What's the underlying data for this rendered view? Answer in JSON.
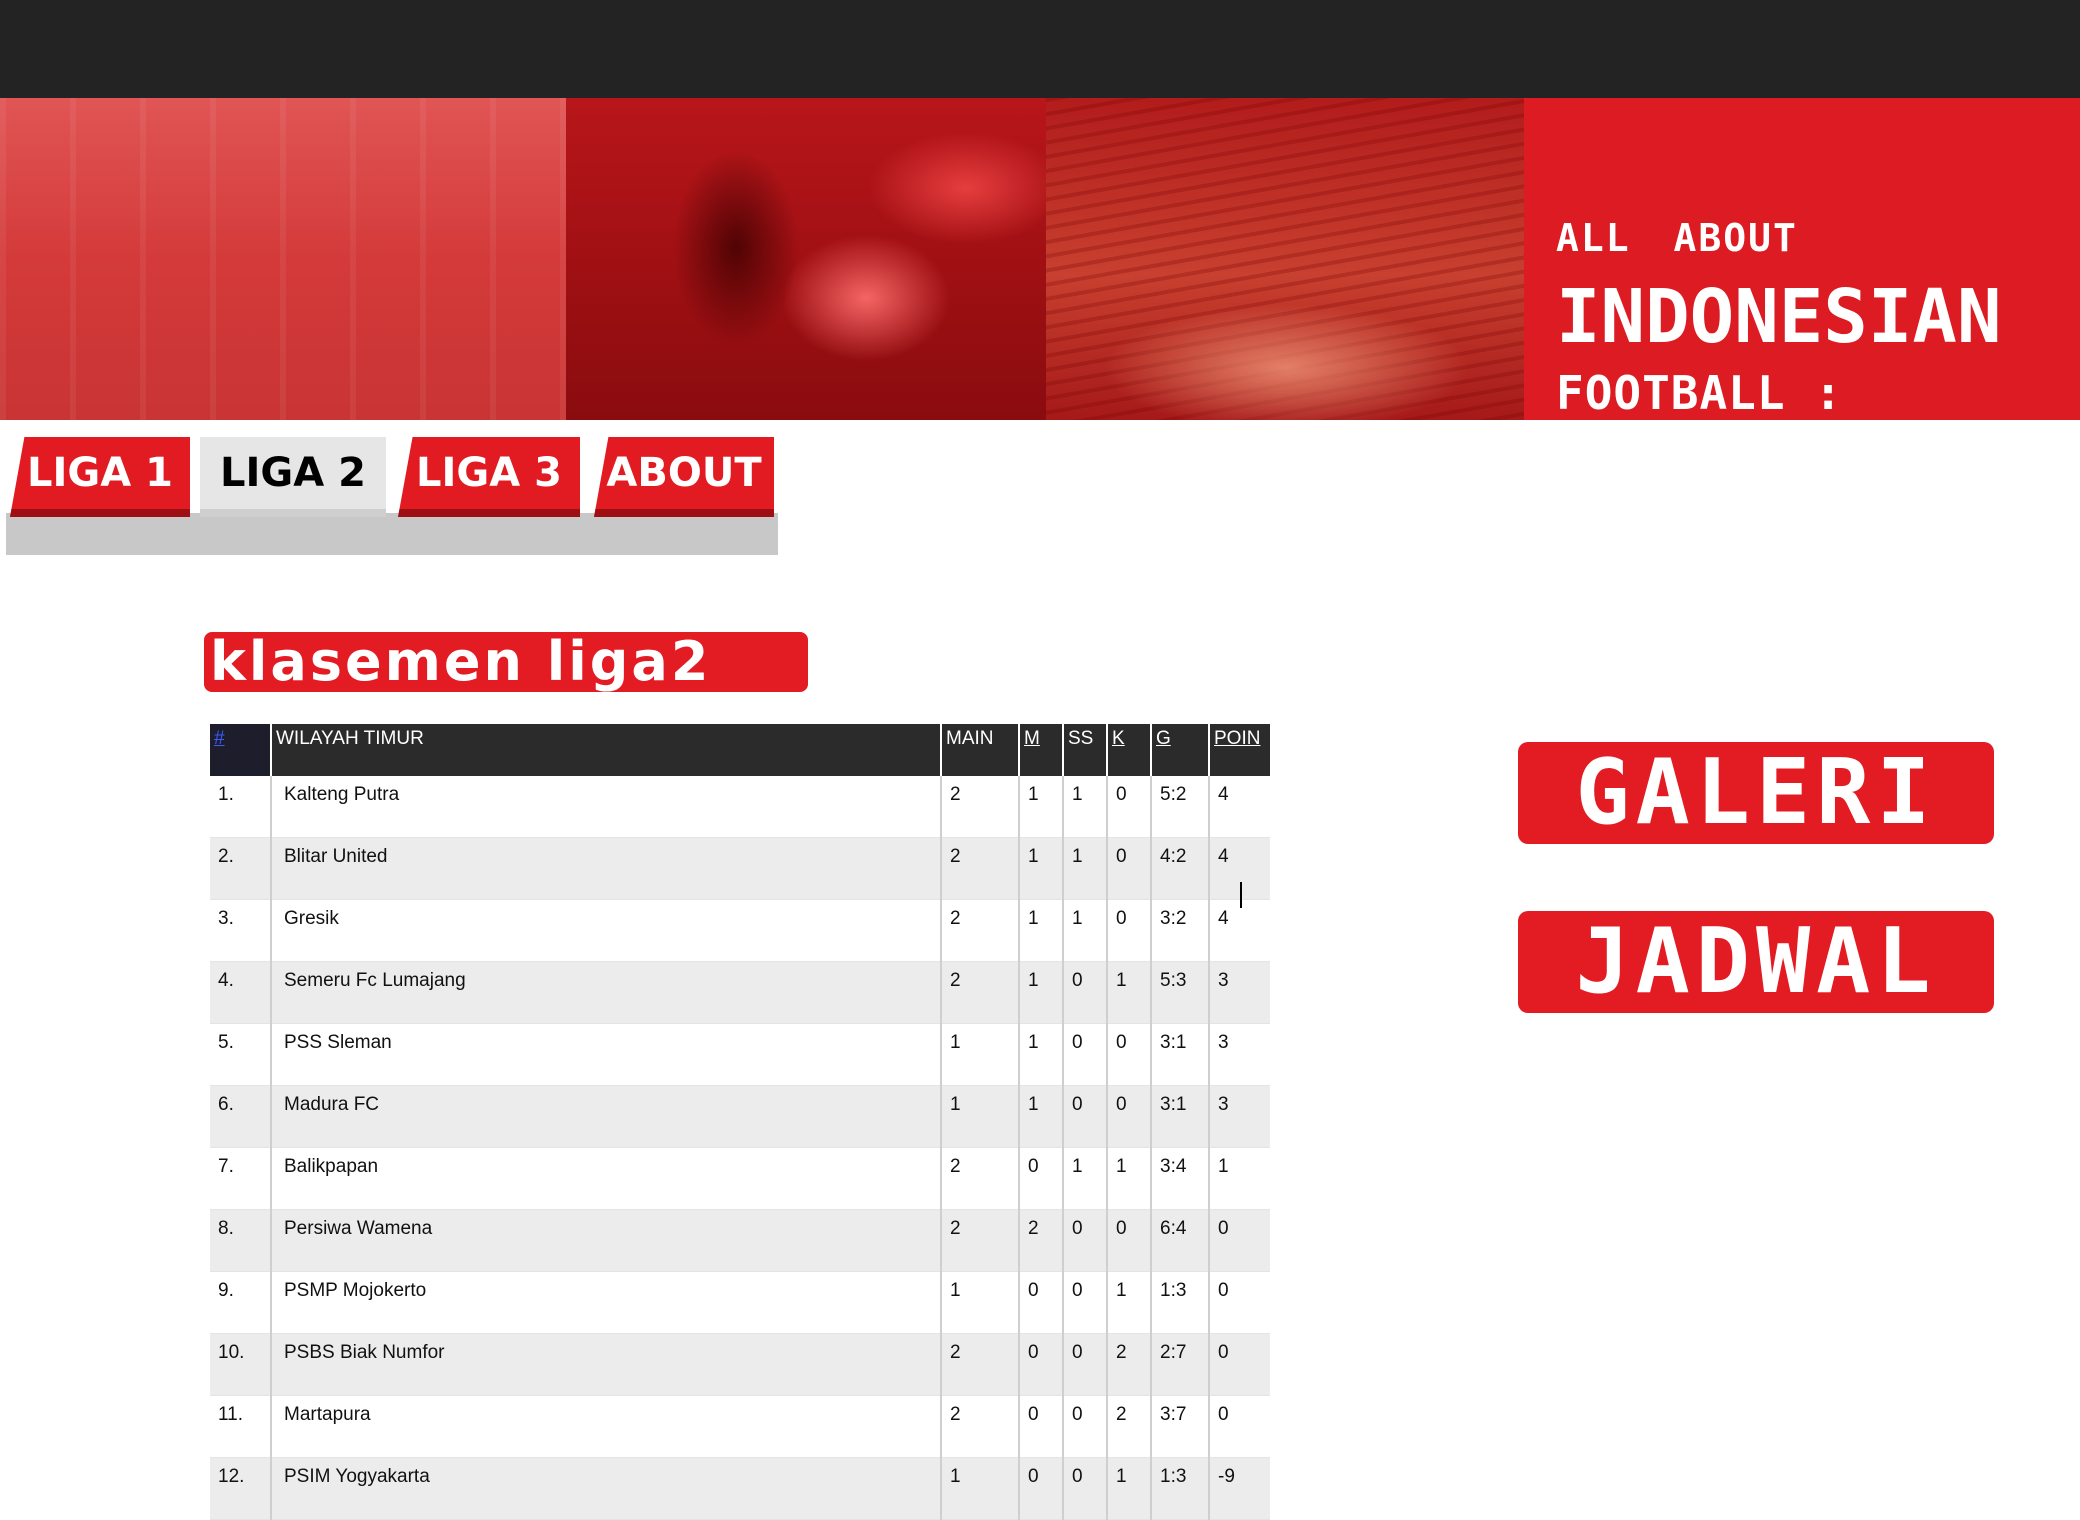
{
  "header": {
    "line1": "ALL ABOUT",
    "line2": "INDONESIAN",
    "line3": "FOOTBALL :"
  },
  "nav": {
    "tabs": [
      {
        "label": "LIGA 1",
        "active": false
      },
      {
        "label": "LIGA 2",
        "active": true
      },
      {
        "label": "LIGA 3",
        "active": false
      },
      {
        "label": "ABOUT",
        "active": false
      }
    ]
  },
  "main": {
    "title": "klasemen liga2",
    "table": {
      "headers": [
        "#",
        "WILAYAH TIMUR",
        "MAIN",
        "M",
        "SS",
        "K",
        "G",
        "POIN"
      ],
      "rows": [
        [
          "1.",
          "Kalteng Putra",
          "2",
          "1",
          "1",
          "0",
          "5:2",
          "4"
        ],
        [
          "2.",
          "Blitar United",
          "2",
          "1",
          "1",
          "0",
          "4:2",
          "4"
        ],
        [
          "3.",
          "Gresik",
          "2",
          "1",
          "1",
          "0",
          "3:2",
          "4"
        ],
        [
          "4.",
          "Semeru Fc Lumajang",
          "2",
          "1",
          "0",
          "1",
          "5:3",
          "3"
        ],
        [
          "5.",
          "PSS Sleman",
          "1",
          "1",
          "0",
          "0",
          "3:1",
          "3"
        ],
        [
          "6.",
          "Madura FC",
          "1",
          "1",
          "0",
          "0",
          "3:1",
          "3"
        ],
        [
          "7.",
          "Balikpapan",
          "2",
          "0",
          "1",
          "1",
          "3:4",
          "1"
        ],
        [
          "8.",
          "Persiwa Wamena",
          "2",
          "2",
          "0",
          "0",
          "6:4",
          "0"
        ],
        [
          "9.",
          "PSMP Mojokerto",
          "1",
          "0",
          "0",
          "1",
          "1:3",
          "0"
        ],
        [
          "10.",
          "PSBS Biak Numfor",
          "2",
          "0",
          "0",
          "2",
          "2:7",
          "0"
        ],
        [
          "11.",
          "Martapura",
          "2",
          "0",
          "0",
          "2",
          "3:7",
          "0"
        ],
        [
          "12.",
          "PSIM Yogyakarta",
          "1",
          "0",
          "0",
          "1",
          "1:3",
          "-9"
        ]
      ]
    }
  },
  "sidebar": {
    "galeri_label": "GALERI",
    "jadwal_label": "JADWAL"
  },
  "colors": {
    "brand_red": "#e31b23",
    "top_bar": "#232323",
    "header_text": "#ffffff"
  }
}
